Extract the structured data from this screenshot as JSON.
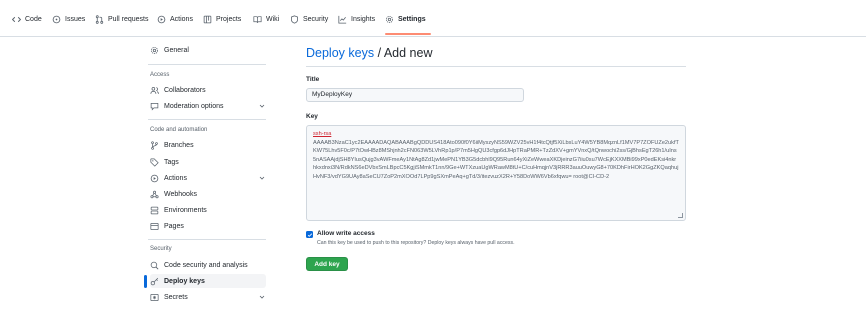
{
  "repo_nav": {
    "tabs": [
      {
        "label": "Code",
        "icon": "code-icon"
      },
      {
        "label": "Issues",
        "icon": "issue-icon"
      },
      {
        "label": "Pull requests",
        "icon": "pull-request-icon"
      },
      {
        "label": "Actions",
        "icon": "actions-icon"
      },
      {
        "label": "Projects",
        "icon": "projects-icon"
      },
      {
        "label": "Wiki",
        "icon": "book-icon"
      },
      {
        "label": "Security",
        "icon": "shield-icon"
      },
      {
        "label": "Insights",
        "icon": "graph-icon"
      },
      {
        "label": "Settings",
        "icon": "gear-icon",
        "selected": true
      }
    ]
  },
  "sidebar": {
    "general": "General",
    "access_heading": "Access",
    "access_items": [
      "Collaborators",
      "Moderation options"
    ],
    "code_heading": "Code and automation",
    "code_items": [
      "Branches",
      "Tags",
      "Actions",
      "Webhooks",
      "Environments",
      "Pages"
    ],
    "security_heading": "Security",
    "security_items": [
      "Code security and analysis",
      "Deploy keys",
      "Secrets"
    ],
    "active_item": "Deploy keys"
  },
  "main": {
    "breadcrumb_link": "Deploy keys",
    "breadcrumb_sep": " / ",
    "breadcrumb_current": "Add new",
    "title_label": "Title",
    "title_value": "MyDeployKey",
    "key_label": "Key",
    "key_prefix": "ssh-rsa",
    "key_body": "AAAAB3NzaC1yc2EAAAADAQABAAABgQDDUS418Ato090f0Y6iiMyszyNS59WZV25vH1f4tcQtjf5XiLbsLuY4W5YB8MqznLf1MV7P7ZOFUZe2ukfTKW75Lhv5F0c/P7tOwHBz8MShjnh2cFN063W5LVhRp1p/P7m5HgQU3cfgp6dJHpTRaPMR+TzZdXV+gmYVnxQ/tQnwochi2ss/GjBhsEgT26h1/uIns5nASAAjdjSH8YIusQujg3vAWFmeAy1NtAg8Zd1jwMePN1YB3G5dcbhl9Q95Run64yXiZeWweaXKDjeinzG7iiu0su7WcEjKXXMBi99xP0edEKsi4nkrhkxdnxi3N/RdkNS6eDVbxSmLBpcC5KgjiSMmkT1nn/9Ge+WTXzuaUgWRawM8tU+C/cuHmqjnV3jRRR3auuOuwyG8+70KDhFirHOK2GgZKQaqhujHvNF3/vdYG9UAy8aSeCU7ZoP2mXOOd7LPp9gSXmPeAq+gTd/3/itezvuzX2R+Y58DoWW6Vb6xfqwu= root@CI-CD-2",
    "allow_write_label": "Allow write access",
    "allow_write_checked": true,
    "allow_write_note": "Can this key be used to push to this repository? Deploy keys always have pull access.",
    "submit_label": "Add key"
  },
  "colors": {
    "link": "#0969da",
    "button": "#2da44e",
    "selected_tab_underline": "#fd8c73"
  }
}
